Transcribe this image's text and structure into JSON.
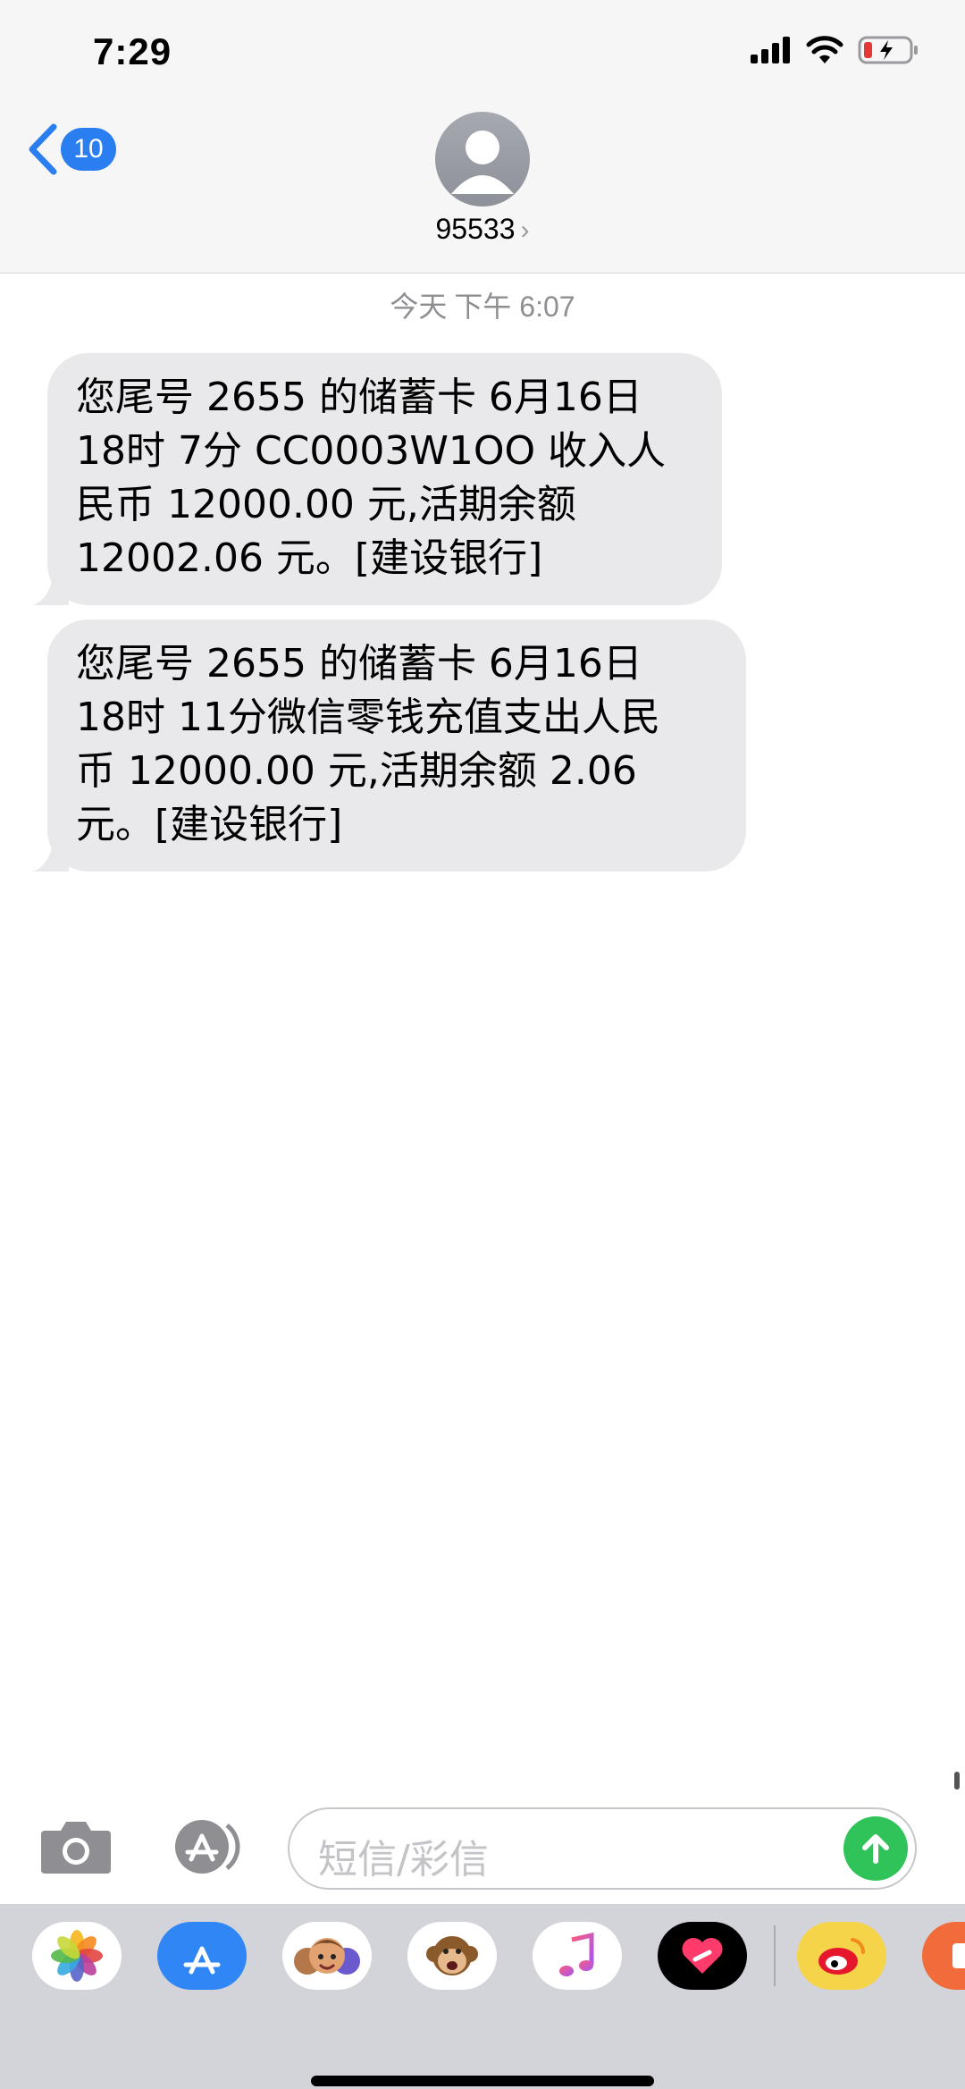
{
  "status": {
    "time": "7:29"
  },
  "header": {
    "back_count": "10",
    "contact": "95533"
  },
  "conversation": {
    "timestamp_day": "今天",
    "timestamp_time": "下午 6:07",
    "messages": [
      {
        "lines": [
          "您尾号 2655 的储蓄卡 6月16日",
          "18时 7分 CC0003W1OO 收入人",
          "民币 12000.00 元,活期余额",
          "12002.06 元。[建设银行]"
        ]
      },
      {
        "lines": [
          "您尾号 2655 的储蓄卡 6月16日",
          "18时 11分微信零钱充值支出人民",
          "币 12000.00 元,活期余额 2.06",
          "元。[建设银行]"
        ]
      }
    ]
  },
  "compose": {
    "placeholder": "短信/彩信"
  },
  "tray": {
    "apps": [
      "photos-icon",
      "app-store-icon",
      "memoji-icon",
      "animoji-monkey-icon",
      "music-icon",
      "digital-touch-icon",
      "weibo-icon",
      "app-icon"
    ]
  },
  "colors": {
    "accent": "#2a7ef0",
    "send": "#2fc35a",
    "bubble": "#e9e9eb"
  }
}
